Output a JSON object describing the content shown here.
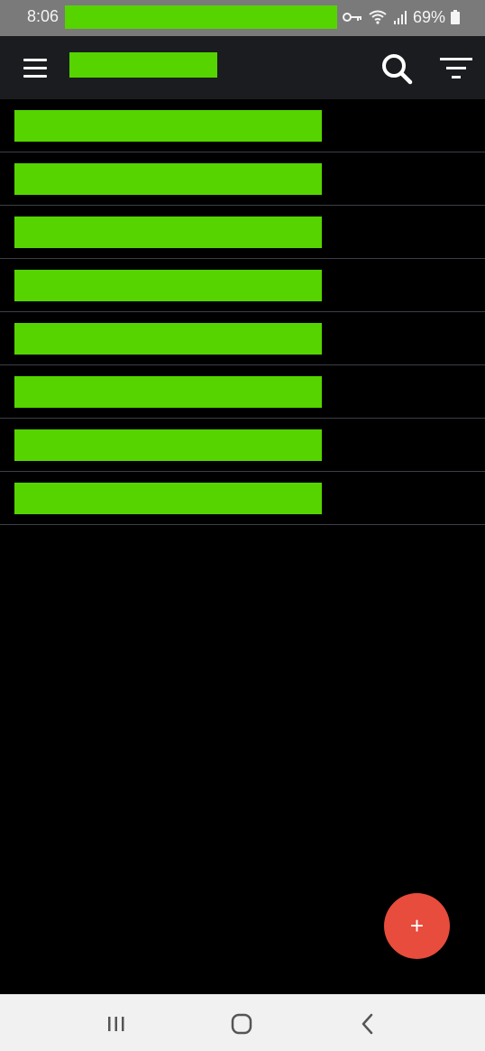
{
  "status_bar": {
    "time": "8:06",
    "battery": "69%",
    "redacted_color": "#55d400"
  },
  "app_bar": {
    "background": "#1b1c1f",
    "icons": [
      "menu-icon",
      "search-icon",
      "filter-icon"
    ]
  },
  "list": {
    "item_count": 8,
    "redacted_color": "#55d400",
    "divider_color": "#3d3f45"
  },
  "fab": {
    "label": "+",
    "color": "#e74c3c"
  },
  "nav_bar": {
    "icons": [
      "recents-icon",
      "home-icon",
      "back-icon"
    ]
  }
}
